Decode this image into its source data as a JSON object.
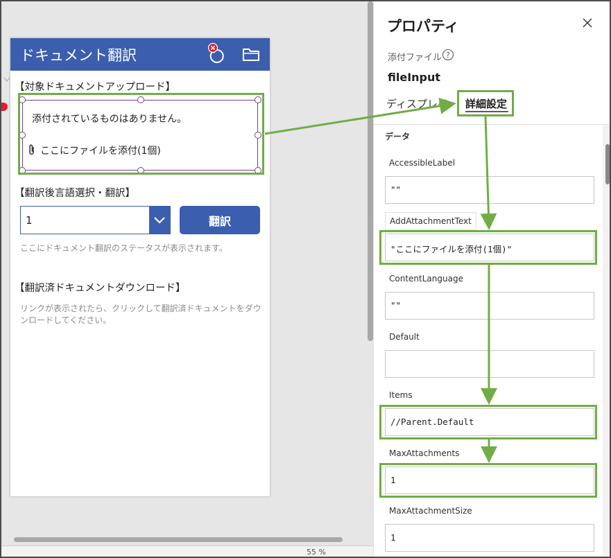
{
  "app": {
    "title": "ドキュメント翻訳",
    "upload_label": "【対象ドキュメントアップロード】",
    "upload_empty_text": "添付されているものはありません。",
    "upload_add_text": "ここにファイルを添付(1個)",
    "lang_label": "【翻訳後言語選択・翻訳】",
    "lang_value": "1",
    "translate_button": "翻訳",
    "status_text": "ここにドキュメント翻訳のステータスが表示されます。",
    "download_label": "【翻訳済ドキュメントダウンロード】",
    "download_note": "リンクが表示されたら、クリックして翻訳済ドキュメントをダウンロードしてください。",
    "header_color": "#3b5fae",
    "icons": {
      "reset": "reset-icon",
      "folder": "folder-icon",
      "error": "error-badge-icon",
      "attachment": "paperclip-icon"
    }
  },
  "panel": {
    "title": "プロパティ",
    "control_type": "添付ファイル",
    "control_name": "fileInput",
    "tabs": [
      {
        "label": "ディスプレイ",
        "active": false
      },
      {
        "label": "詳細設定",
        "active": true
      }
    ],
    "section": "データ",
    "properties": [
      {
        "name": "AccessibleLabel",
        "value": "\"\""
      },
      {
        "name": "AddAttachmentText",
        "value": "\"ここにファイルを添付(1個)\""
      },
      {
        "name": "ContentLanguage",
        "value": "\"\""
      },
      {
        "name": "Default",
        "value": ""
      },
      {
        "name": "Items",
        "value": "//Parent.Default"
      },
      {
        "name": "MaxAttachments",
        "value": "1"
      },
      {
        "name": "MaxAttachmentSize",
        "value": "1"
      }
    ],
    "accent_color": "#7e3d86"
  },
  "annotation_color": "#70ad47",
  "status_bar": {
    "zoom": "55 %"
  }
}
